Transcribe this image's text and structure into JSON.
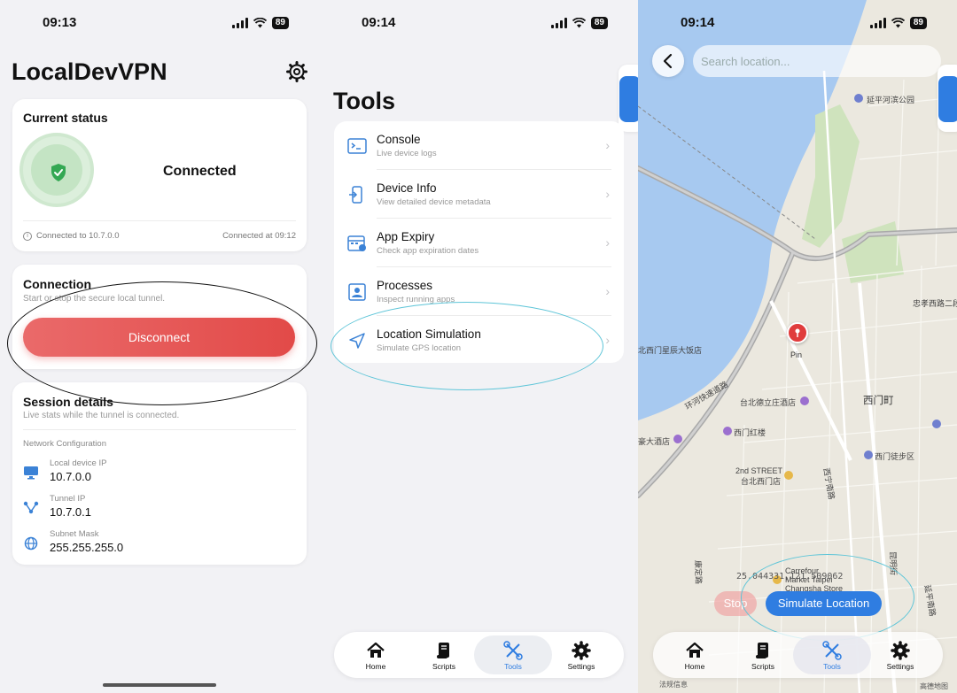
{
  "status_bar": {
    "time_1": "09:13",
    "time_2": "09:14",
    "time_3": "09:14",
    "battery": "89"
  },
  "home": {
    "title": "LocalDevVPN",
    "status_card": {
      "title": "Current status",
      "state": "Connected",
      "connected_to": "Connected to 10.7.0.0",
      "connected_at": "Connected at 09:12"
    },
    "connection_card": {
      "title": "Connection",
      "subtitle": "Start or stop the secure local tunnel.",
      "button": "Disconnect"
    },
    "session_card": {
      "title": "Session details",
      "subtitle": "Live stats while the tunnel is connected.",
      "network_label": "Network Configuration",
      "rows": [
        {
          "label": "Local device IP",
          "value": "10.7.0.0",
          "icon": "monitor-icon"
        },
        {
          "label": "Tunnel IP",
          "value": "10.7.0.1",
          "icon": "network-icon"
        },
        {
          "label": "Subnet Mask",
          "value": "255.255.255.0",
          "icon": "globe-icon"
        }
      ]
    }
  },
  "tools": {
    "title": "Tools",
    "items": [
      {
        "name": "Console",
        "desc": "Live device logs",
        "icon": "terminal-icon"
      },
      {
        "name": "Device Info",
        "desc": "View detailed device metadata",
        "icon": "device-info-icon"
      },
      {
        "name": "App Expiry",
        "desc": "Check app expiration dates",
        "icon": "calendar-icon"
      },
      {
        "name": "Processes",
        "desc": "Inspect running apps",
        "icon": "processes-icon"
      },
      {
        "name": "Location Simulation",
        "desc": "Simulate GPS location",
        "icon": "location-arrow-icon"
      }
    ]
  },
  "tabbar": {
    "items": [
      "Home",
      "Scripts",
      "Tools",
      "Settings"
    ],
    "active": "Tools"
  },
  "map": {
    "search_placeholder": "Search location...",
    "labels": [
      "延平河滨公园",
      "忠孝西路二段",
      "北西门星辰大饭店",
      "西门町",
      "台北德立庄酒店",
      "环河快速道路",
      "西门红楼",
      "豪大酒店",
      "西门徒步区",
      "2nd STREET",
      "台北西门店",
      "西宁南路",
      "康定路",
      "昆明街",
      "Carrefour",
      "Market Taipei",
      "Changsha Store",
      "延平南路",
      "法规信息",
      "高德地图"
    ],
    "pin_label": "Pin",
    "coordinate": "25.044331,121.509062",
    "stop_button": "Stop",
    "simulate_button": "Simulate Location"
  },
  "colors": {
    "accent": "#2f7de1",
    "danger": "#e24a48",
    "success": "#34a853",
    "annotation_cyan": "#5ec5d8"
  }
}
